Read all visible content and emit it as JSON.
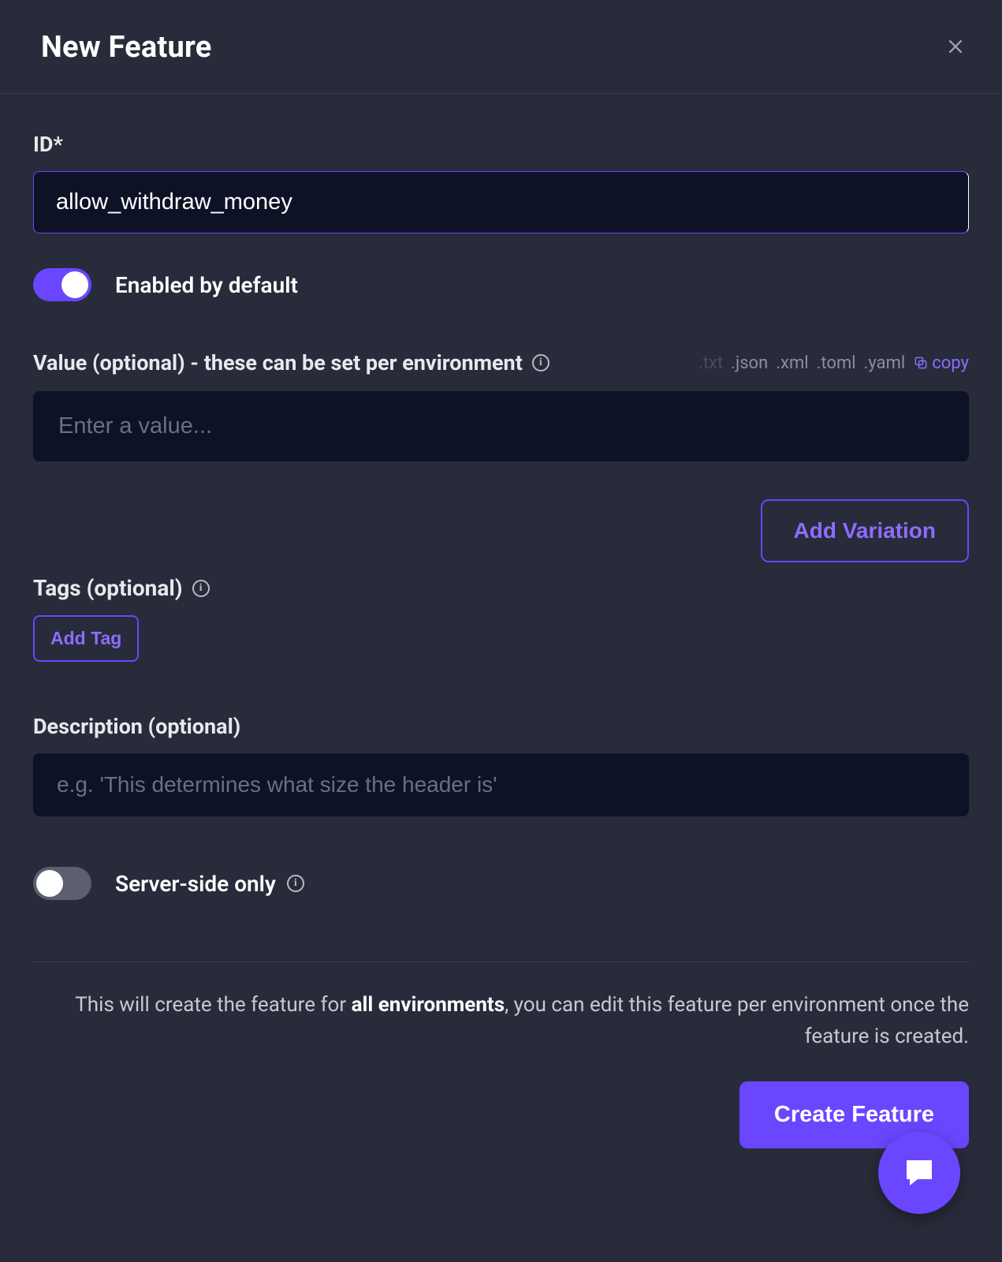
{
  "header": {
    "title": "New Feature"
  },
  "form": {
    "id_label": "ID*",
    "id_value": "allow_withdraw_money",
    "enabled_toggle_label": "Enabled by default",
    "enabled_toggle_on": true,
    "value_label": "Value (optional) - these can be set per environment",
    "value_placeholder": "Enter a value...",
    "value_formats": {
      "txt": ".txt",
      "json": ".json",
      "xml": ".xml",
      "toml": ".toml",
      "yaml": ".yaml"
    },
    "copy_label": "copy",
    "add_variation_label": "Add Variation",
    "tags_label": "Tags (optional)",
    "add_tag_label": "Add Tag",
    "description_label": "Description (optional)",
    "description_placeholder": "e.g. 'This determines what size the header is'",
    "server_side_label": "Server-side only",
    "server_side_on": false
  },
  "footer": {
    "note_prefix": "This will create the feature for ",
    "note_bold": "all environments",
    "note_suffix": ", you can edit this feature per environment once the feature is created.",
    "create_button": "Create Feature"
  }
}
